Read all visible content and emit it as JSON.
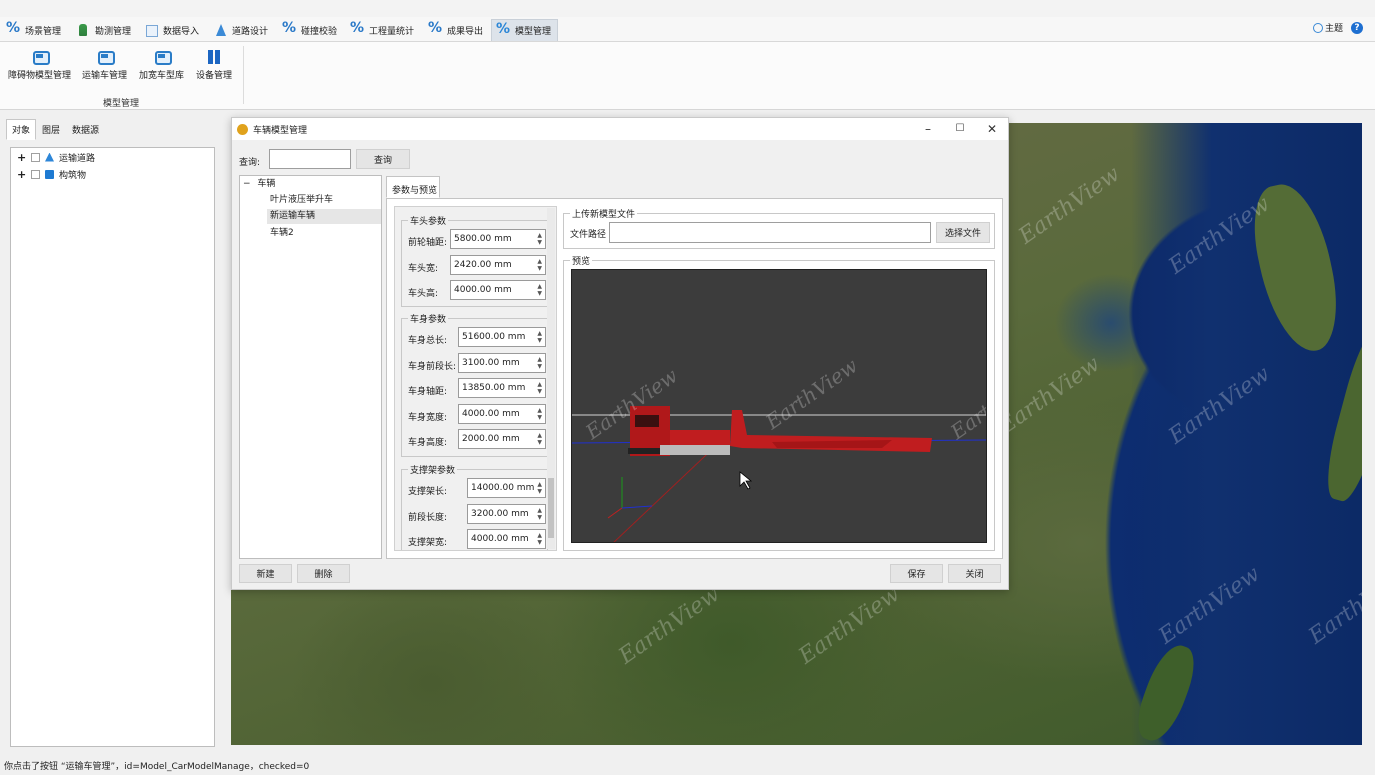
{
  "menubar": {
    "tabs": [
      {
        "label": "场景管理",
        "icon": "scene-icon"
      },
      {
        "label": "勘测管理",
        "icon": "survey-icon"
      },
      {
        "label": "数据导入",
        "icon": "import-icon"
      },
      {
        "label": "道路设计",
        "icon": "road-icon"
      },
      {
        "label": "碰撞校验",
        "icon": "collision-icon"
      },
      {
        "label": "工程量统计",
        "icon": "quantity-icon"
      },
      {
        "label": "成果导出",
        "icon": "export-icon"
      },
      {
        "label": "模型管理",
        "icon": "model-icon"
      }
    ],
    "active_tab": "模型管理",
    "theme_label": "主题",
    "help_label": "?"
  },
  "ribbon": {
    "buttons": [
      {
        "label": "障碍物模型管理",
        "icon": "obstacle-model-icon"
      },
      {
        "label": "运输车管理",
        "icon": "transport-car-icon"
      },
      {
        "label": "加宽车型库",
        "icon": "widened-car-icon"
      },
      {
        "label": "设备管理",
        "icon": "device-icon"
      }
    ],
    "group_label": "模型管理"
  },
  "left_panel": {
    "tabs": [
      "对象",
      "图层",
      "数据源"
    ],
    "tree": [
      {
        "label": "运输道路",
        "icon": "road-layer-icon"
      },
      {
        "label": "构筑物",
        "icon": "structure-icon"
      }
    ]
  },
  "dialog": {
    "title": "车辆模型管理",
    "controls": {
      "minimize": "–",
      "maximize": "☐",
      "close": "✕"
    },
    "query_label": "查询:",
    "query_value": "",
    "query_button": "查询",
    "tree": {
      "root": "车辆",
      "expander": "−",
      "children": [
        "叶片液压举升车",
        "新运输车辆",
        "车辆2"
      ],
      "selected": "新运输车辆"
    },
    "tab_label": "参数与预览",
    "head_params": {
      "title": "车头参数",
      "rows": [
        {
          "label": "前轮轴距:",
          "value": "5800.00 mm"
        },
        {
          "label": "车头宽:",
          "value": "2420.00 mm"
        },
        {
          "label": "车头高:",
          "value": "4000.00 mm"
        }
      ]
    },
    "body_params": {
      "title": "车身参数",
      "rows": [
        {
          "label": "车身总长:",
          "value": "51600.00 mm"
        },
        {
          "label": "车身前段长:",
          "value": "3100.00 mm"
        },
        {
          "label": "车身轴距:",
          "value": "13850.00 mm"
        },
        {
          "label": "车身宽度:",
          "value": "4000.00 mm"
        },
        {
          "label": "车身高度:",
          "value": "2000.00 mm"
        }
      ]
    },
    "support_params": {
      "title": "支撑架参数",
      "rows": [
        {
          "label": "支撑架长:",
          "value": "14000.00 mm"
        },
        {
          "label": "前段长度:",
          "value": "3200.00 mm"
        },
        {
          "label": "支撑架宽:",
          "value": "4000.00 mm"
        }
      ]
    },
    "upload": {
      "title": "上传新模型文件",
      "path_label": "文件路径",
      "path_value": "",
      "choose_button": "选择文件"
    },
    "preview_title": "预览",
    "preview_watermark": "EarthView",
    "buttons": {
      "new": "新建",
      "delete": "删除",
      "save": "保存",
      "close": "关闭"
    }
  },
  "map": {
    "watermark": "EarthView"
  },
  "status_bar": "你点击了按钮 “运输车管理”，id=Model_CarModelManage，checked=0"
}
